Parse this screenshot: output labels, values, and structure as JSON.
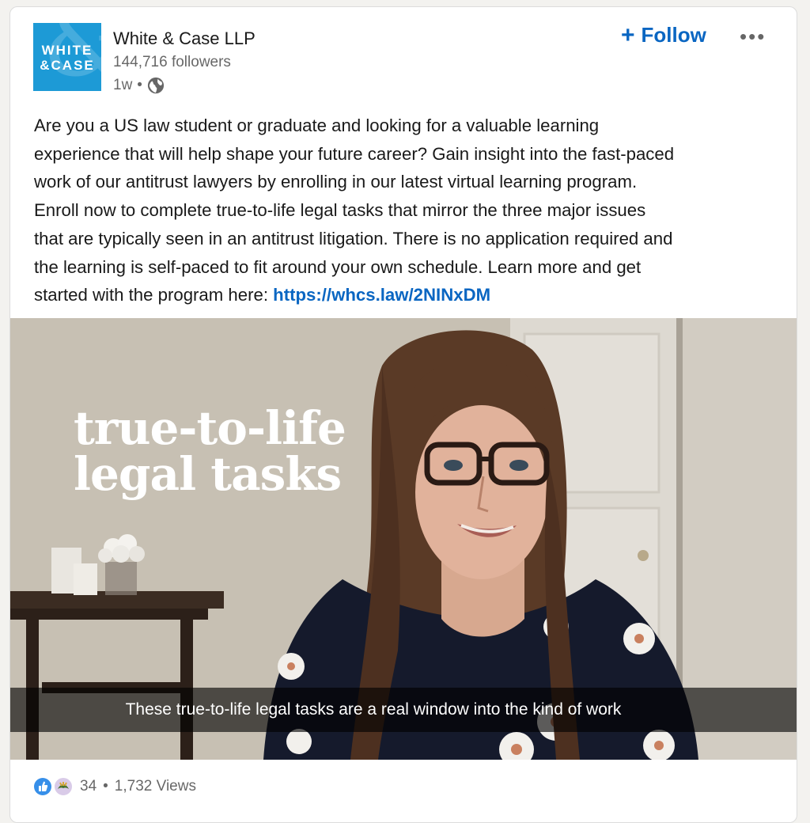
{
  "company": {
    "name": "White & Case LLP",
    "followers": "144,716 followers",
    "time": "1w",
    "separator": "•",
    "logo_line1": "WHITE",
    "logo_line2": "&CASE",
    "logo_icon": "white-case-logo"
  },
  "actions": {
    "follow_label": "Follow",
    "follow_icon": "plus-icon",
    "more_label": "•••",
    "more_icon": "more-icon"
  },
  "post": {
    "lines": [
      "Are you a US law student or graduate and looking for a valuable learning",
      "experience that will help shape your future career? Gain insight into the fast-paced",
      "work of our antitrust lawyers by enrolling in our latest virtual learning program.",
      "Enroll now to complete true-to-life legal tasks that mirror the three major issues",
      "that are typically seen in an antitrust litigation. There is no application required and",
      "the learning is self-paced to fit around your own schedule. Learn more and get"
    ],
    "last_line_prefix": "started with the program here: ",
    "link": "https://whcs.law/2NINxDM"
  },
  "video": {
    "overlay_line1": "true-to-life",
    "overlay_line2": "legal tasks",
    "caption": "These true-to-life legal tasks are a real window into the kind of work"
  },
  "footer": {
    "reaction_count": "34",
    "separator": "•",
    "views": "1,732 Views",
    "reaction_icons": [
      "like-icon",
      "support-icon"
    ]
  },
  "colors": {
    "link_blue": "#0a66c2",
    "logo_blue": "#1d9ad6",
    "like_blue": "#378fe9"
  }
}
